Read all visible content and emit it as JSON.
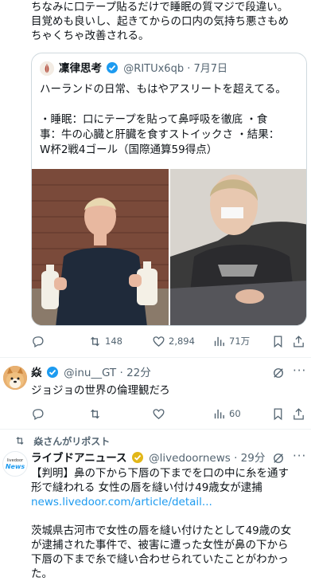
{
  "tweet1": {
    "text_line1": "ちなみに口テープ貼るだけで睡眠の質マジで段違い。",
    "text_line2": "目覚めも良いし、起きてからの口内の気持ち悪さもめ",
    "text_line3": "ちゃくちゃ改善される。",
    "quote": {
      "author_name": "凜律思考",
      "handle": "@RITUx6qb",
      "date": "· 7月7日",
      "line1": "ハーランドの日常、もはやアスリートを超えてる。",
      "line2": "・睡眠：口にテープを貼って鼻呼吸を徹底 ・食",
      "line3": "事：牛の心臓と肝臓を食すストイックさ ・結果：",
      "line4": "W杯2戦4ゴール（国際通算59得点）"
    },
    "actions": {
      "replies": "",
      "retweets": "148",
      "likes": "2,894",
      "views": "71万"
    }
  },
  "tweet2": {
    "author_name": "焱",
    "handle": "@inu__GT",
    "time": "· 22分",
    "text": "ジョジョの世界の倫理観だろ",
    "actions": {
      "replies": "",
      "retweets": "",
      "likes": "",
      "views": "60"
    }
  },
  "tweet3": {
    "repost_label": "焱さんがリポスト",
    "author_name": "ライブドアニュース",
    "handle": "@livedoornews",
    "time": "· 29分",
    "avatar_text_top": "livedoor",
    "avatar_text_bottom": "News",
    "line1": "【判明】鼻の下から下唇の下までを口の中に糸を通す",
    "line2": "形で縫われる 女性の唇を縫い付け49歳女が逮捕",
    "link": "news.livedoor.com/article/detail...",
    "para_line1": "茨城県古河市で女性の唇を縫い付けたとして49歳の女",
    "para_line2": "が逮捕された事件で、被害に遭った女性が鼻の下から",
    "para_line3": "下唇の下まで糸で縫い合わせられていたことがわかっ",
    "para_line4": "た。"
  },
  "colors": {
    "accent": "#1d9bf0",
    "verified_gold": "#e2b719",
    "text": "#0f1419",
    "muted": "#536471"
  }
}
